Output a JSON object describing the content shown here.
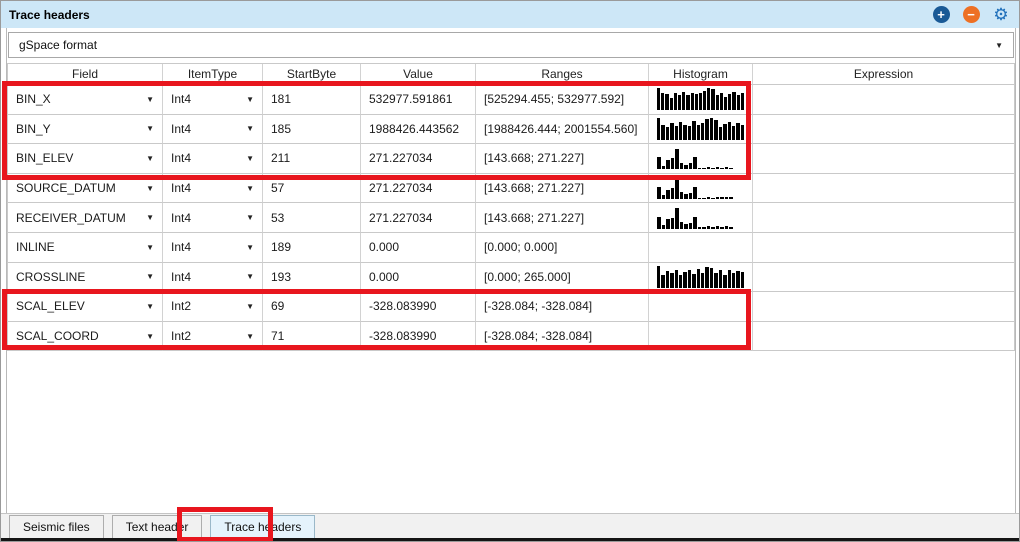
{
  "panel": {
    "title": "Trace headers"
  },
  "toolbar": {
    "add_icon": "plus-circle",
    "remove_icon": "minus-circle",
    "settings_icon": "gear",
    "colors": {
      "add": "#1a5a96",
      "remove": "#ed7024",
      "settings": "#1e6fba"
    }
  },
  "format_selector": {
    "value": "gSpace format"
  },
  "table": {
    "columns": [
      "Field",
      "ItemType",
      "StartByte",
      "Value",
      "Ranges",
      "Histogram",
      "Expression"
    ],
    "rows": [
      {
        "field": "BIN_X",
        "item_type": "Int4",
        "start_byte": "181",
        "value": "532977.591861",
        "ranges": "[525294.455; 532977.592]",
        "expression": "",
        "histogram": [
          1,
          0.78,
          0.72,
          0.55,
          0.8,
          0.7,
          0.82,
          0.68,
          0.78,
          0.72,
          0.8,
          0.88,
          1,
          0.95,
          0.68,
          0.8,
          0.6,
          0.75,
          0.82,
          0.7,
          0.78
        ]
      },
      {
        "field": "BIN_Y",
        "item_type": "Int4",
        "start_byte": "185",
        "value": "1988426.443562",
        "ranges": "[1988426.444; 2001554.560]",
        "expression": "",
        "histogram": [
          1,
          0.7,
          0.6,
          0.78,
          0.65,
          0.8,
          0.7,
          0.62,
          0.85,
          0.7,
          0.78,
          0.95,
          1,
          0.9,
          0.6,
          0.72,
          0.8,
          0.65,
          0.78,
          0.7
        ]
      },
      {
        "field": "BIN_ELEV",
        "item_type": "Int4",
        "start_byte": "211",
        "value": "271.227034",
        "ranges": "[143.668; 271.227]",
        "expression": "",
        "histogram": [
          0.55,
          0.18,
          0.42,
          0.5,
          0.92,
          0.3,
          0.22,
          0.28,
          0.55,
          0.07,
          0.07,
          0.1,
          0.07,
          0.1,
          0.08,
          0.1,
          0.08
        ]
      },
      {
        "field": "SOURCE_DATUM",
        "item_type": "Int4",
        "start_byte": "57",
        "value": "271.227034",
        "ranges": "[143.668; 271.227]",
        "expression": "",
        "histogram": [
          0.55,
          0.18,
          0.42,
          0.5,
          0.92,
          0.3,
          0.22,
          0.28,
          0.55,
          0.07,
          0.07,
          0.1,
          0.07,
          0.1,
          0.08,
          0.1,
          0.08
        ]
      },
      {
        "field": "RECEIVER_DATUM",
        "item_type": "Int4",
        "start_byte": "53",
        "value": "271.227034",
        "ranges": "[143.668; 271.227]",
        "expression": "",
        "histogram": [
          0.55,
          0.18,
          0.42,
          0.5,
          0.92,
          0.3,
          0.22,
          0.28,
          0.55,
          0.07,
          0.07,
          0.1,
          0.07,
          0.1,
          0.08,
          0.1,
          0.08
        ]
      },
      {
        "field": "INLINE",
        "item_type": "Int4",
        "start_byte": "189",
        "value": "0.000",
        "ranges": "[0.000; 0.000]",
        "expression": "",
        "histogram": []
      },
      {
        "field": "CROSSLINE",
        "item_type": "Int4",
        "start_byte": "193",
        "value": "0.000",
        "ranges": "[0.000; 265.000]",
        "expression": "",
        "histogram": [
          1,
          0.6,
          0.75,
          0.68,
          0.8,
          0.58,
          0.72,
          0.8,
          0.62,
          0.85,
          0.68,
          0.95,
          0.9,
          0.66,
          0.8,
          0.6,
          0.82,
          0.68,
          0.78,
          0.72
        ]
      },
      {
        "field": "SCAL_ELEV",
        "item_type": "Int2",
        "start_byte": "69",
        "value": "-328.083990",
        "ranges": "[-328.084; -328.084]",
        "expression": "",
        "histogram": []
      },
      {
        "field": "SCAL_COORD",
        "item_type": "Int2",
        "start_byte": "71",
        "value": "-328.083990",
        "ranges": "[-328.084; -328.084]",
        "expression": "",
        "histogram": []
      }
    ]
  },
  "tabs": [
    {
      "label": "Seismic files",
      "active": false
    },
    {
      "label": "Text header",
      "active": false
    },
    {
      "label": "Trace headers",
      "active": true
    }
  ],
  "colors": {
    "titlebar_bg": "#cde7f7",
    "annotation_red": "#e8161e",
    "active_tab_bg": "#e5f3fc"
  }
}
